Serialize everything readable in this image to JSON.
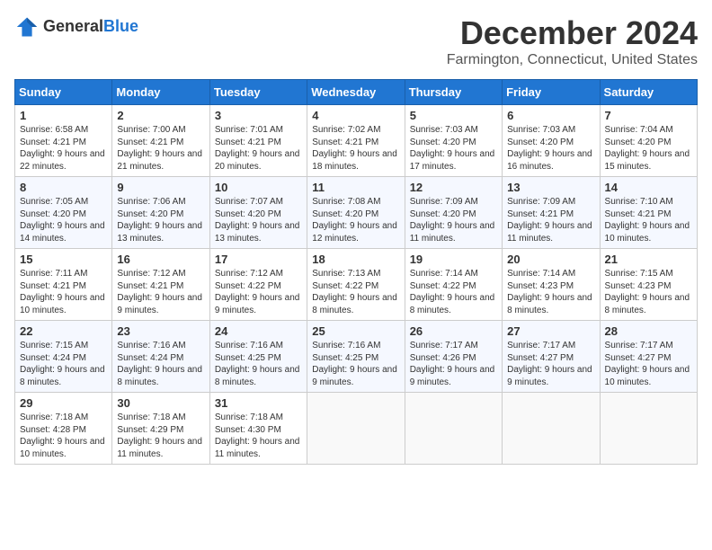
{
  "header": {
    "logo_general": "General",
    "logo_blue": "Blue",
    "month_title": "December 2024",
    "location": "Farmington, Connecticut, United States"
  },
  "days_of_week": [
    "Sunday",
    "Monday",
    "Tuesday",
    "Wednesday",
    "Thursday",
    "Friday",
    "Saturday"
  ],
  "weeks": [
    [
      {
        "day": "1",
        "sunrise": "6:58 AM",
        "sunset": "4:21 PM",
        "daylight": "9 hours and 22 minutes."
      },
      {
        "day": "2",
        "sunrise": "7:00 AM",
        "sunset": "4:21 PM",
        "daylight": "9 hours and 21 minutes."
      },
      {
        "day": "3",
        "sunrise": "7:01 AM",
        "sunset": "4:21 PM",
        "daylight": "9 hours and 20 minutes."
      },
      {
        "day": "4",
        "sunrise": "7:02 AM",
        "sunset": "4:21 PM",
        "daylight": "9 hours and 18 minutes."
      },
      {
        "day": "5",
        "sunrise": "7:03 AM",
        "sunset": "4:20 PM",
        "daylight": "9 hours and 17 minutes."
      },
      {
        "day": "6",
        "sunrise": "7:03 AM",
        "sunset": "4:20 PM",
        "daylight": "9 hours and 16 minutes."
      },
      {
        "day": "7",
        "sunrise": "7:04 AM",
        "sunset": "4:20 PM",
        "daylight": "9 hours and 15 minutes."
      }
    ],
    [
      {
        "day": "8",
        "sunrise": "7:05 AM",
        "sunset": "4:20 PM",
        "daylight": "9 hours and 14 minutes."
      },
      {
        "day": "9",
        "sunrise": "7:06 AM",
        "sunset": "4:20 PM",
        "daylight": "9 hours and 13 minutes."
      },
      {
        "day": "10",
        "sunrise": "7:07 AM",
        "sunset": "4:20 PM",
        "daylight": "9 hours and 13 minutes."
      },
      {
        "day": "11",
        "sunrise": "7:08 AM",
        "sunset": "4:20 PM",
        "daylight": "9 hours and 12 minutes."
      },
      {
        "day": "12",
        "sunrise": "7:09 AM",
        "sunset": "4:20 PM",
        "daylight": "9 hours and 11 minutes."
      },
      {
        "day": "13",
        "sunrise": "7:09 AM",
        "sunset": "4:21 PM",
        "daylight": "9 hours and 11 minutes."
      },
      {
        "day": "14",
        "sunrise": "7:10 AM",
        "sunset": "4:21 PM",
        "daylight": "9 hours and 10 minutes."
      }
    ],
    [
      {
        "day": "15",
        "sunrise": "7:11 AM",
        "sunset": "4:21 PM",
        "daylight": "9 hours and 10 minutes."
      },
      {
        "day": "16",
        "sunrise": "7:12 AM",
        "sunset": "4:21 PM",
        "daylight": "9 hours and 9 minutes."
      },
      {
        "day": "17",
        "sunrise": "7:12 AM",
        "sunset": "4:22 PM",
        "daylight": "9 hours and 9 minutes."
      },
      {
        "day": "18",
        "sunrise": "7:13 AM",
        "sunset": "4:22 PM",
        "daylight": "9 hours and 8 minutes."
      },
      {
        "day": "19",
        "sunrise": "7:14 AM",
        "sunset": "4:22 PM",
        "daylight": "9 hours and 8 minutes."
      },
      {
        "day": "20",
        "sunrise": "7:14 AM",
        "sunset": "4:23 PM",
        "daylight": "9 hours and 8 minutes."
      },
      {
        "day": "21",
        "sunrise": "7:15 AM",
        "sunset": "4:23 PM",
        "daylight": "9 hours and 8 minutes."
      }
    ],
    [
      {
        "day": "22",
        "sunrise": "7:15 AM",
        "sunset": "4:24 PM",
        "daylight": "9 hours and 8 minutes."
      },
      {
        "day": "23",
        "sunrise": "7:16 AM",
        "sunset": "4:24 PM",
        "daylight": "9 hours and 8 minutes."
      },
      {
        "day": "24",
        "sunrise": "7:16 AM",
        "sunset": "4:25 PM",
        "daylight": "9 hours and 8 minutes."
      },
      {
        "day": "25",
        "sunrise": "7:16 AM",
        "sunset": "4:25 PM",
        "daylight": "9 hours and 9 minutes."
      },
      {
        "day": "26",
        "sunrise": "7:17 AM",
        "sunset": "4:26 PM",
        "daylight": "9 hours and 9 minutes."
      },
      {
        "day": "27",
        "sunrise": "7:17 AM",
        "sunset": "4:27 PM",
        "daylight": "9 hours and 9 minutes."
      },
      {
        "day": "28",
        "sunrise": "7:17 AM",
        "sunset": "4:27 PM",
        "daylight": "9 hours and 10 minutes."
      }
    ],
    [
      {
        "day": "29",
        "sunrise": "7:18 AM",
        "sunset": "4:28 PM",
        "daylight": "9 hours and 10 minutes."
      },
      {
        "day": "30",
        "sunrise": "7:18 AM",
        "sunset": "4:29 PM",
        "daylight": "9 hours and 11 minutes."
      },
      {
        "day": "31",
        "sunrise": "7:18 AM",
        "sunset": "4:30 PM",
        "daylight": "9 hours and 11 minutes."
      },
      null,
      null,
      null,
      null
    ]
  ],
  "labels": {
    "sunrise": "Sunrise:",
    "sunset": "Sunset:",
    "daylight": "Daylight:"
  }
}
